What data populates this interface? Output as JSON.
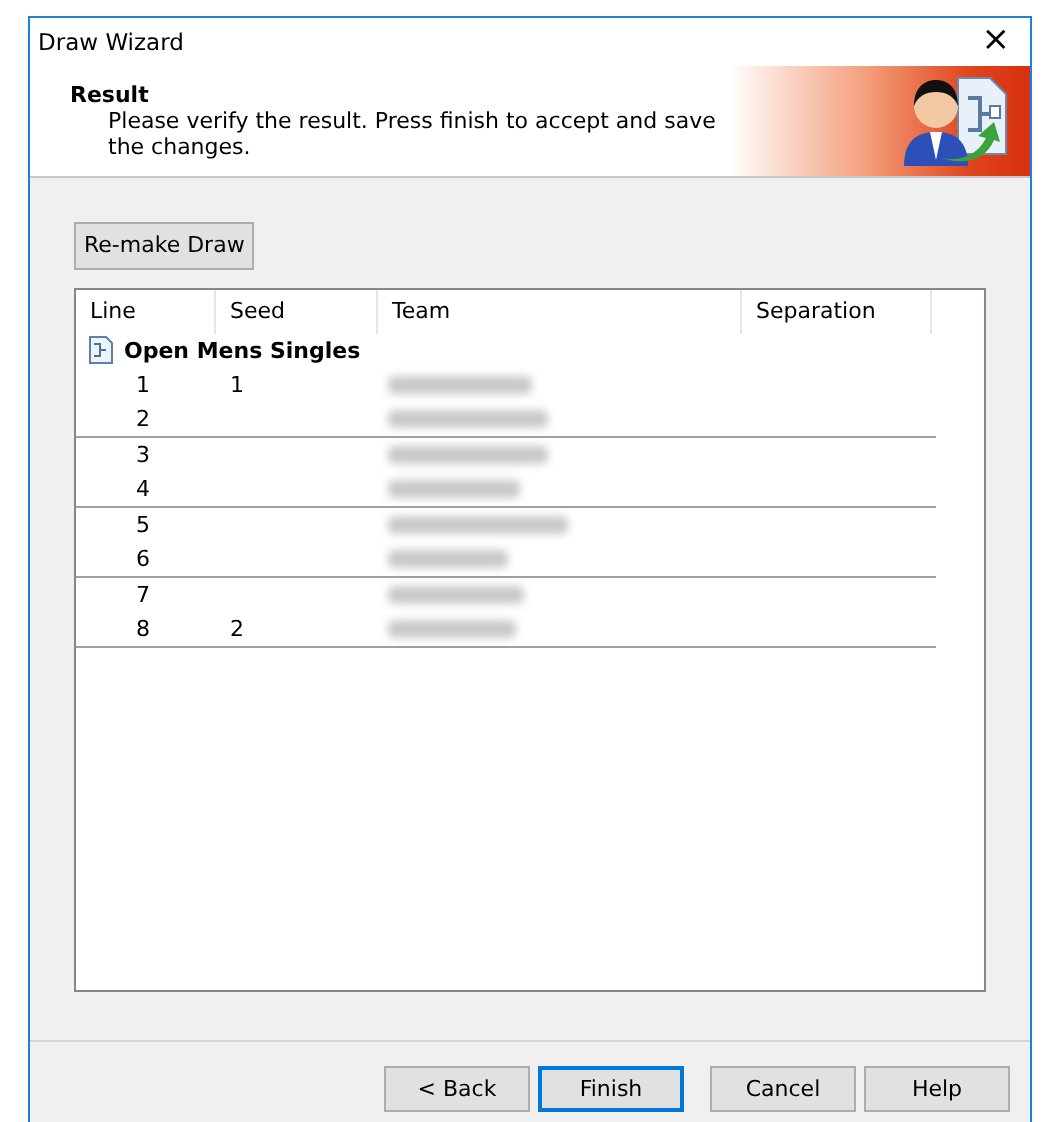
{
  "window": {
    "title": "Draw Wizard",
    "close": "×"
  },
  "header": {
    "title": "Result",
    "description": "Please verify the result. Press finish to accept and save the changes."
  },
  "remake_button": "Re-make Draw",
  "table": {
    "columns": [
      "Line",
      "Seed",
      "Team",
      "Separation"
    ],
    "group": {
      "name": "Open Mens Singles"
    },
    "pairs": [
      {
        "rows": [
          {
            "line": "1",
            "seed": "1"
          },
          {
            "line": "2",
            "seed": ""
          }
        ]
      },
      {
        "rows": [
          {
            "line": "3",
            "seed": ""
          },
          {
            "line": "4",
            "seed": ""
          }
        ]
      },
      {
        "rows": [
          {
            "line": "5",
            "seed": ""
          },
          {
            "line": "6",
            "seed": ""
          }
        ]
      },
      {
        "rows": [
          {
            "line": "7",
            "seed": ""
          },
          {
            "line": "8",
            "seed": "2"
          }
        ]
      }
    ]
  },
  "buttons": [
    {
      "label": "< Back",
      "kind": "normal"
    },
    {
      "label": "Finish",
      "kind": "default"
    },
    {
      "label": "Cancel",
      "kind": "normal"
    },
    {
      "label": "Help",
      "kind": "normal"
    }
  ]
}
